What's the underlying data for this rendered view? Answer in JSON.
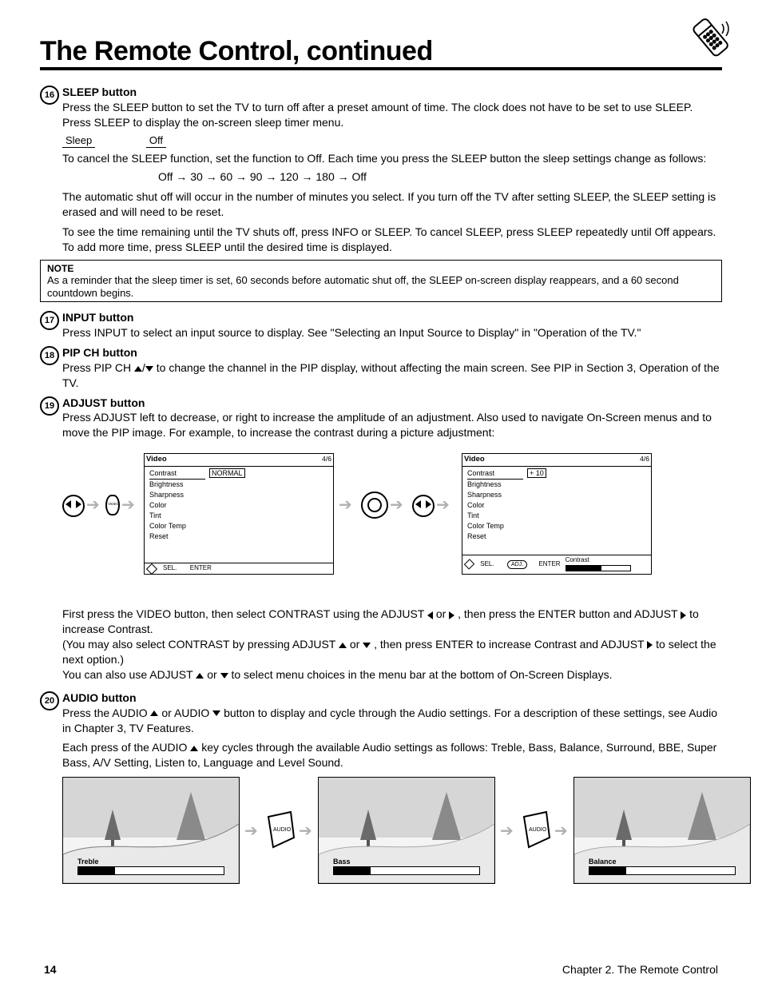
{
  "header": {
    "title": "The Remote Control, continued"
  },
  "items": {
    "n16": {
      "title": "SLEEP button",
      "intro": "Press the SLEEP button to set the TV to turn off after a preset amount of time. The clock does not have to be set to use SLEEP. Press SLEEP to display the on-screen sleep timer menu.",
      "lbl_sleep": "Sleep",
      "opt_off": "Off",
      "paraA": "To cancel the SLEEP function, set the function to Off. Each time you press the SLEEP button the sleep settings change as follows:",
      "seq": "Off → 30 → 60 → 90 → 120 → 180 → Off",
      "paraB": "The automatic shut off will occur in the number of minutes you select. If you turn off the TV after setting SLEEP, the SLEEP setting is erased and will need to be reset.",
      "paraC": "To see the time remaining until the TV shuts off, press INFO or SLEEP. To cancel SLEEP, press SLEEP repeatedly until Off appears. To add more time, press SLEEP until the desired time is displayed."
    },
    "note": {
      "hd": "NOTE",
      "body": "As a reminder that the sleep timer is set, 60 seconds before automatic shut off, the SLEEP on-screen display reappears, and a 60 second countdown begins."
    },
    "n17": {
      "title": "INPUT button",
      "body": "Press INPUT to select an input source to display. See \"Selecting an Input Source to Display\" in \"Operation of the TV.\""
    },
    "n18": {
      "title": "PIP CH button",
      "body": "Press PIP CH",
      "body2": "to change the channel in the PIP display, without affecting the main screen. See PIP in Section 3, Operation of the TV."
    },
    "n19": {
      "title": "ADJUST button",
      "body": "Press ADJUST left to decrease, or right to increase the amplitude of an adjustment. Also used to navigate On-Screen menus and to move the PIP image. For example, to increase the contrast during a picture adjustment:",
      "lineA_pre": "First press the VIDEO button, then select CONTRAST using the ADJUST",
      "lineA_mid": "or",
      "lineA_post": ", then press the ENTER button and ADJUST",
      "lineA_end": "to increase Contrast.",
      "lineB_pre": "(You may also select CONTRAST by pressing ADJUST",
      "lineB_mid": "or",
      "lineB_post": ", then press ENTER to increase Contrast and ADJUST",
      "lineB_end": "to select the next option.)",
      "lineC_pre": "You can also use ADJUST",
      "lineC_mid": "or",
      "lineC_post": "to select menu choices in the menu bar at the bottom of On-Screen Displays.",
      "osd": {
        "title": "Video",
        "contrast": "Contrast",
        "selected": "NORMAL",
        "bright": "Brightness",
        "sharp": "Sharpness",
        "color": "Color",
        "tint": "Tint",
        "ct": "Color Temp",
        "reset": "Reset",
        "foot1": "SEL.",
        "foot2": "ENTER",
        "barLabel": "Contrast"
      }
    },
    "n20": {
      "title": "AUDIO button",
      "body_pre": "Press the AUDIO",
      "body_mid": "or AUDIO",
      "body_post": "button to display and cycle through the Audio settings. For a description of these settings, see Audio in Chapter 3, TV Features.",
      "ex_pre": "Each press of the AUDIO",
      "ex_post": "key cycles through the available Audio settings as follows: Treble, Bass, Balance, Surround, BBE, Super Bass, A/V Setting, Listen to, Language and Level Sound.",
      "bar1": "Treble",
      "bar2": "Bass",
      "bar3": "Balance"
    }
  },
  "footer": {
    "left": "14",
    "right": "Chapter 2. The Remote Control"
  }
}
